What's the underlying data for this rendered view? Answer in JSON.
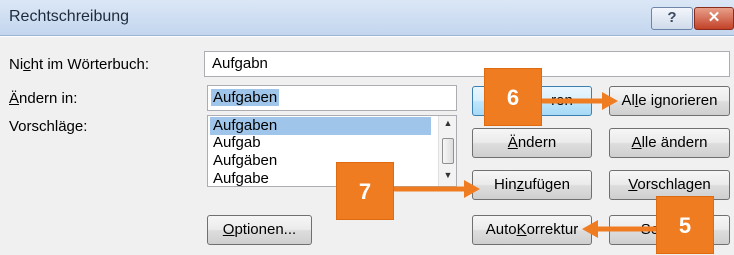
{
  "window": {
    "title": "Rechtschreibung",
    "help_label": "?",
    "close_label": "✕"
  },
  "labels": {
    "not_in_dict_pre": "Ni",
    "not_in_dict_ul": "c",
    "not_in_dict_post": "ht im Wörterbuch:",
    "change_to_ul": "Ä",
    "change_to_post": "ndern in:",
    "suggestions": "Vorschläge:"
  },
  "fields": {
    "not_in_dict_value": "Aufgabn",
    "change_to_value": "Aufgaben"
  },
  "suggestions": {
    "items": [
      "Aufgaben",
      "Aufgab",
      "Aufgäben",
      "Aufgabe"
    ],
    "selected_index": 0,
    "scroll_up": "▲",
    "scroll_down": "▼"
  },
  "buttons": {
    "ignore_partial": "ren",
    "ignore_all_pre": "Al",
    "ignore_all_ul": "l",
    "ignore_all_post": "e ignorieren",
    "change_ul": "Ä",
    "change_post": "ndern",
    "change_all_pre": "",
    "change_all_ul": "A",
    "change_all_post": "lle ändern",
    "add_pre": "Hin",
    "add_ul": "z",
    "add_post": "ufügen",
    "suggest_ul": "V",
    "suggest_post": "orschlagen",
    "options_ul": "O",
    "options_post": "ptionen...",
    "autocorrect_pre": "Auto",
    "autocorrect_ul": "K",
    "autocorrect_post": "orrektur",
    "close_partial": "Sc"
  },
  "callouts": [
    "6",
    "7",
    "5"
  ],
  "colors": {
    "callout": "#f07c22",
    "selection": "#9fc6ea",
    "titlebar": "#c3d6ee"
  }
}
